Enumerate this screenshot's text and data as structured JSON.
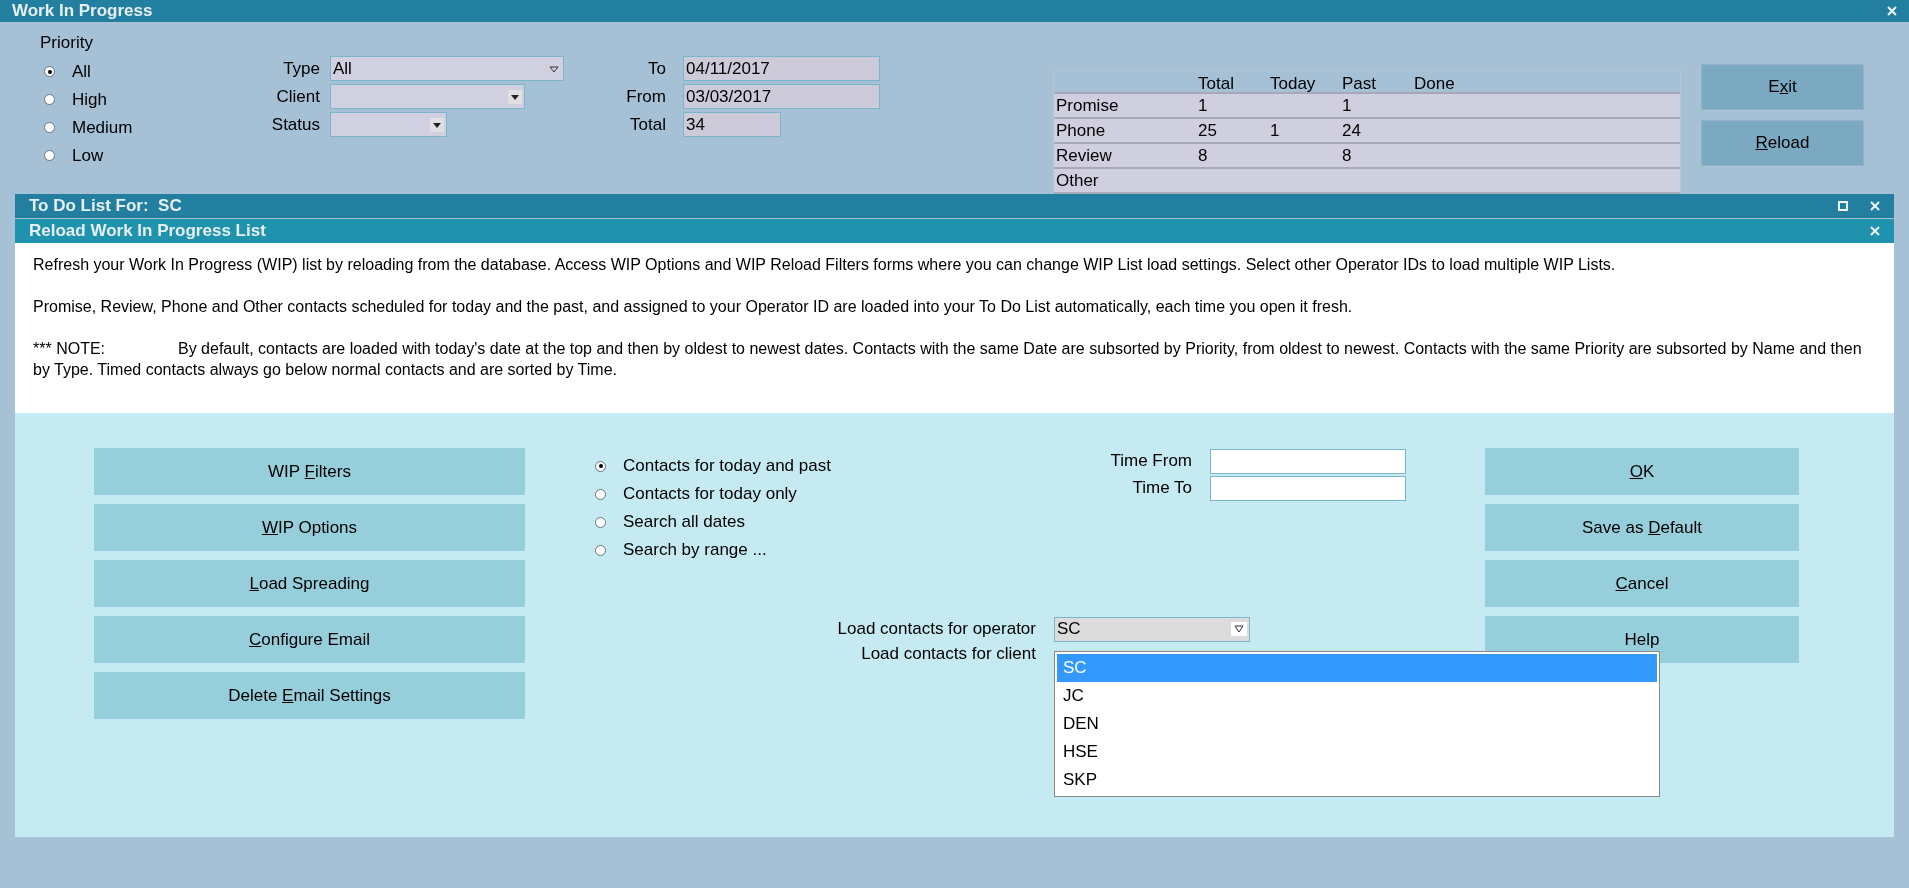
{
  "window": {
    "title": "Work In Progress"
  },
  "priority": {
    "label": "Priority",
    "options": [
      {
        "label": "All",
        "selected": true
      },
      {
        "label": "High",
        "selected": false
      },
      {
        "label": "Medium",
        "selected": false
      },
      {
        "label": "Low",
        "selected": false
      }
    ]
  },
  "filters": [
    {
      "label": "Type",
      "value": "All",
      "kind": "wide"
    },
    {
      "label": "Client",
      "kind": "medium"
    },
    {
      "label": "Status",
      "kind": "narrow"
    }
  ],
  "dates": [
    {
      "label": "To",
      "value": "04/11/2017",
      "kind": "wide"
    },
    {
      "label": "From",
      "value": "03/03/2017",
      "kind": "wide"
    },
    {
      "label": "Total",
      "value": "34",
      "kind": "narrow"
    }
  ],
  "summary": {
    "columns": [
      "Total",
      "Today",
      "Past",
      "Done"
    ],
    "rows": [
      {
        "label": "Promise",
        "cells": [
          "1",
          "",
          "1",
          ""
        ]
      },
      {
        "label": "Phone",
        "cells": [
          "25",
          "1",
          "24",
          ""
        ]
      },
      {
        "label": "Review",
        "cells": [
          "8",
          "",
          "8",
          ""
        ]
      },
      {
        "label": "Other",
        "cells": [
          "",
          "",
          "",
          ""
        ]
      }
    ]
  },
  "top_buttons": [
    {
      "before": "E",
      "key": "x",
      "after": "it"
    },
    {
      "key": "R",
      "after": "eload"
    }
  ],
  "todo_bar": {
    "title": "To Do List For:",
    "operator": "SC"
  },
  "dialog": {
    "title": "Reload Work In Progress List",
    "paragraphs": [
      "Refresh your Work In Progress (WIP) list by reloading from the database. Access WIP Options and WIP Reload Filters forms where you can change WIP List load settings. Select other Operator IDs to load multiple WIP Lists.",
      "Promise, Review, Phone and Other contacts scheduled for today and the past, and assigned to your Operator ID are loaded into your To Do List automatically, each time you open it fresh."
    ],
    "note_label": "*** NOTE:",
    "note": "By default, contacts are loaded with today's date at the top and then by oldest to newest dates. Contacts with the same Date are subsorted by Priority, from oldest to newest. Contacts with the same Priority are subsorted by Name and then by Type. Timed contacts always go below normal contacts and are sorted by Time.",
    "left_buttons": [
      {
        "before": "WIP ",
        "key": "F",
        "after": "ilters"
      },
      {
        "key": "W",
        "after": "IP Options"
      },
      {
        "key": "L",
        "after": "oad Spreading"
      },
      {
        "key": "C",
        "after": "onfigure Email"
      },
      {
        "before": "Delete ",
        "key": "E",
        "after": "mail Settings"
      }
    ],
    "date_options": [
      {
        "label": "Contacts for today and past",
        "selected": true
      },
      {
        "label": "Contacts for today only",
        "selected": false
      },
      {
        "label": "Search all dates",
        "selected": false
      },
      {
        "label": "Search by range ...",
        "selected": false
      }
    ],
    "time_fields": [
      {
        "label": "Time From"
      },
      {
        "label": "Time To"
      }
    ],
    "operator": {
      "label": "Load contacts for operator",
      "value": "SC"
    },
    "client": {
      "label": "Load contacts for client"
    },
    "operator_list": [
      {
        "label": "SC",
        "selected": true
      },
      {
        "label": "JC",
        "selected": false
      },
      {
        "label": "DEN",
        "selected": false
      },
      {
        "label": "HSE",
        "selected": false
      },
      {
        "label": "SKP",
        "selected": false
      }
    ],
    "right_buttons": [
      {
        "key": "O",
        "after": "K"
      },
      {
        "before": "Save as ",
        "key": "D",
        "after": "efault"
      },
      {
        "key": "C",
        "after": "ancel"
      },
      {
        "before": "Help"
      }
    ]
  }
}
